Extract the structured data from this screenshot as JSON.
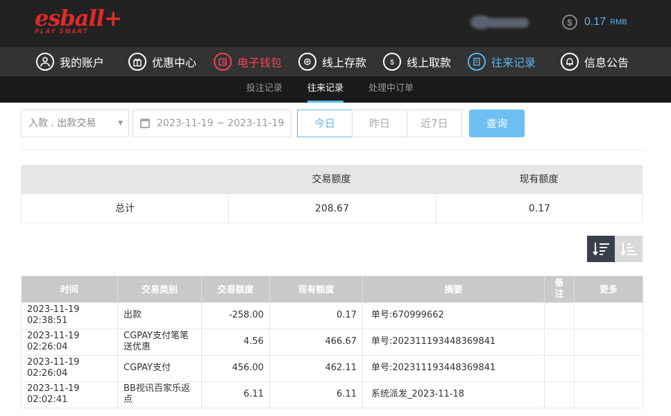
{
  "logo": {
    "main": "esball+",
    "tagline": "PLAY SMART"
  },
  "account": {
    "coin_symbol": "$",
    "balance": "0.17",
    "currency": "RMB"
  },
  "main_nav": [
    {
      "label": "我的账户",
      "icon": "user-icon"
    },
    {
      "label": "优惠中心",
      "icon": "gift-icon"
    },
    {
      "label": "电子钱包",
      "icon": "wallet-icon"
    },
    {
      "label": "线上存款",
      "icon": "deposit-icon"
    },
    {
      "label": "线上取款",
      "icon": "withdraw-icon"
    },
    {
      "label": "往来记录",
      "icon": "records-icon"
    },
    {
      "label": "信息公告",
      "icon": "bell-icon"
    }
  ],
  "sub_nav": [
    {
      "label": "投注记录"
    },
    {
      "label": "往来记录"
    },
    {
      "label": "处理中订单"
    }
  ],
  "filter": {
    "type_value": "入款 . 出款交易",
    "date_range": "2023-11-19 ~ 2023-11-19",
    "quick_ranges": [
      "今日",
      "昨日",
      "近7日"
    ],
    "search_label": "查询"
  },
  "summary": {
    "headers": [
      "",
      "交易额度",
      "现有额度"
    ],
    "row_label": "总计",
    "amount": "208.67",
    "balance": "0.17"
  },
  "records": {
    "headers": [
      "时间",
      "交易类别",
      "交易额度",
      "现有额度",
      "摘要",
      "备注",
      "更多"
    ],
    "rows": [
      {
        "time": "2023-11-19 02:38:51",
        "type": "出款",
        "amount": "-258.00",
        "balance": "0.17",
        "summary": "单号:670999662"
      },
      {
        "time": "2023-11-19 02:26:04",
        "type": "CGPAY支付笔笔送优惠",
        "amount": "4.56",
        "balance": "466.67",
        "summary": "单号:202311193448369841"
      },
      {
        "time": "2023-11-19 02:26:04",
        "type": "CGPAY支付",
        "amount": "456.00",
        "balance": "462.11",
        "summary": "单号:202311193448369841"
      },
      {
        "time": "2023-11-19 02:02:41",
        "type": "BB视讯百家乐返点",
        "amount": "6.11",
        "balance": "6.11",
        "summary": "系统派发_2023-11-18"
      }
    ]
  },
  "colors": {
    "accent": "#5bb5f0",
    "wallet_red": "#f0445a",
    "logo_red": "#e02a2a"
  }
}
